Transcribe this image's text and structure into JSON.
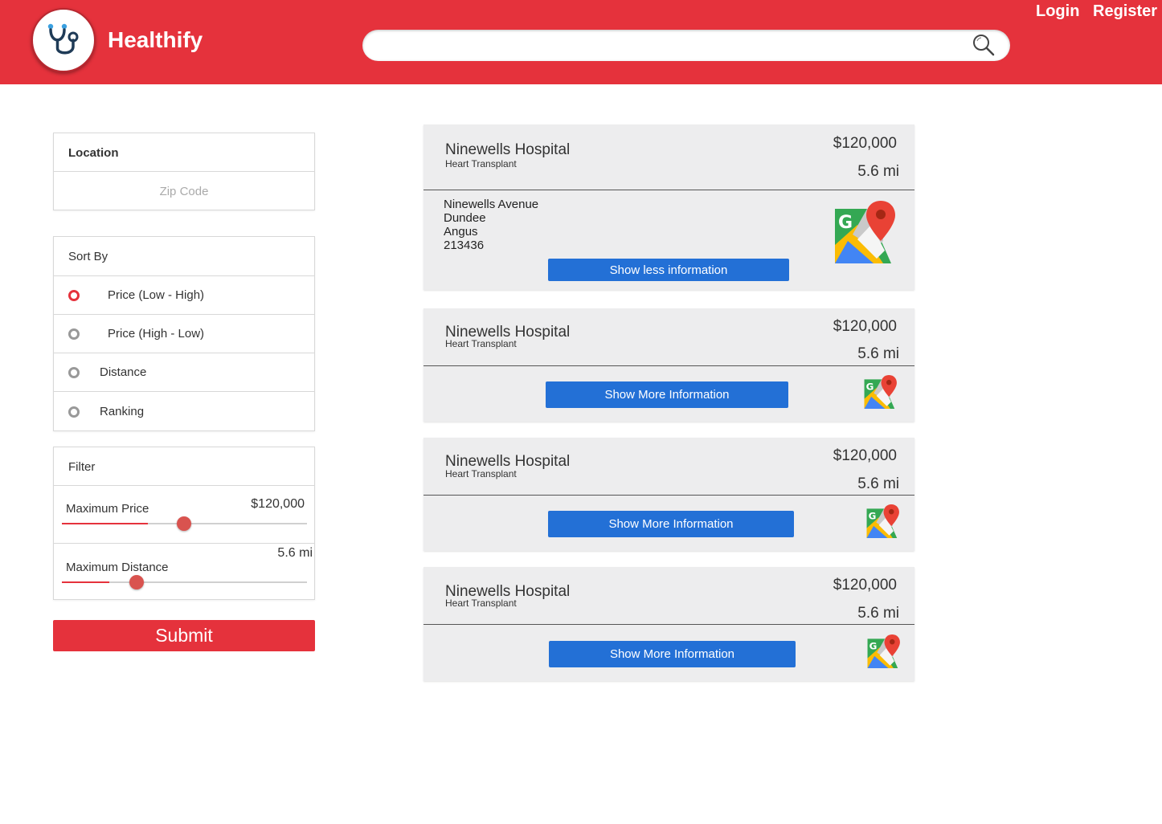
{
  "header": {
    "brand": "Healthify",
    "search_placeholder": "",
    "login_label": "Login",
    "register_label": "Register",
    "accent_color": "#e5323c"
  },
  "sidebar": {
    "location": {
      "title": "Location",
      "zip_placeholder": "Zip Code"
    },
    "sort": {
      "title": "Sort By",
      "options": [
        {
          "label": "Price (Low - High)",
          "selected": true
        },
        {
          "label": "Price (High - Low)",
          "selected": false
        },
        {
          "label": "Distance",
          "selected": false
        },
        {
          "label": "Ranking",
          "selected": false
        }
      ]
    },
    "filter": {
      "title": "Filter",
      "max_price_label": "Maximum Price",
      "max_price_value": "$120,000",
      "max_price_fraction": 0.5,
      "max_distance_label": "Maximum Distance",
      "max_distance_value": "5.6 mi",
      "max_distance_fraction": 0.31
    },
    "submit_label": "Submit"
  },
  "results": [
    {
      "name": "Ninewells Hospital",
      "procedure": "Heart Transplant",
      "price": "$120,000",
      "distance": "5.6 mi",
      "address": [
        "Ninewells Avenue",
        "Dundee",
        "Angus",
        "213436"
      ],
      "button_label": "Show less information",
      "expanded": true
    },
    {
      "name": "Ninewells Hospital",
      "procedure": "Heart Transplant",
      "price": "$120,000",
      "distance": "5.6 mi",
      "button_label": "Show More Information",
      "expanded": false
    },
    {
      "name": "Ninewells Hospital",
      "procedure": "Heart Transplant",
      "price": "$120,000",
      "distance": "5.6 mi",
      "button_label": "Show More Information",
      "expanded": false
    },
    {
      "name": "Ninewells Hospital",
      "procedure": "Heart Transplant",
      "price": "$120,000",
      "distance": "5.6 mi",
      "button_label": "Show More Information",
      "expanded": false
    }
  ]
}
